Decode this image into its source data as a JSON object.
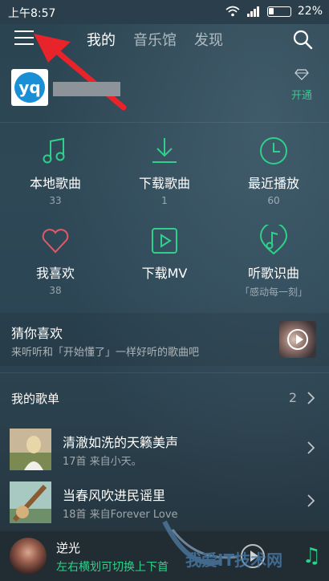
{
  "status_bar": {
    "time": "上午8:57",
    "battery": "22%",
    "battery_level": 0.22
  },
  "header": {
    "tabs": [
      {
        "label": "我的",
        "active": true
      },
      {
        "label": "音乐馆",
        "active": false
      },
      {
        "label": "发现",
        "active": false
      }
    ]
  },
  "profile": {
    "avatar_text": "yq",
    "vip_label": "开通"
  },
  "grid": [
    {
      "icon": "music-note-icon",
      "title": "本地歌曲",
      "sub": "33"
    },
    {
      "icon": "download-icon",
      "title": "下载歌曲",
      "sub": "1"
    },
    {
      "icon": "clock-icon",
      "title": "最近播放",
      "sub": "60"
    },
    {
      "icon": "heart-icon",
      "title": "我喜欢",
      "sub": "38"
    },
    {
      "icon": "download-mv-icon",
      "title": "下载MV",
      "sub": ""
    },
    {
      "icon": "music-recognition-icon",
      "title": "听歌识曲",
      "sub": "「感动每一刻」"
    }
  ],
  "guess": {
    "title": "猜你喜欢",
    "desc": "来听听和「开始懂了」一样好听的歌曲吧"
  },
  "playlists": {
    "title": "我的歌单",
    "count": "2",
    "items": [
      {
        "title": "清澈如洗的天籁美声",
        "desc": "17首 来自小天。"
      },
      {
        "title": "当春风吹进民谣里",
        "desc": "18首 来自Forever Love"
      }
    ]
  },
  "player": {
    "song": "逆光",
    "hint": "左右横划可切换上下首"
  },
  "watermark": {
    "text": "我爱IT技术网"
  },
  "colors": {
    "accent": "#2ed08a",
    "annotation_arrow": "#e8232a"
  }
}
